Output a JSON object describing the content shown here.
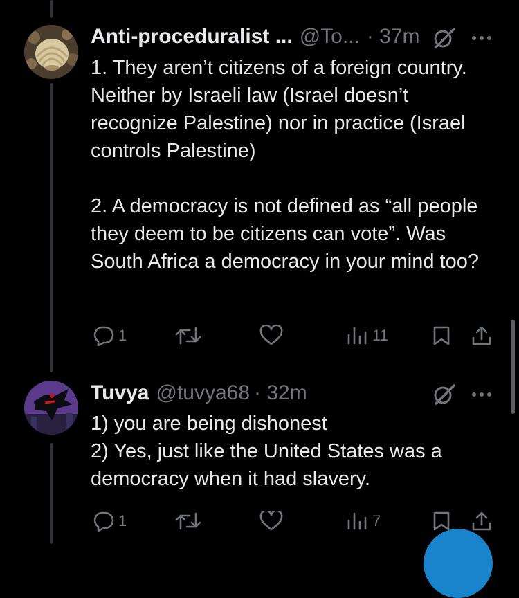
{
  "tweets": [
    {
      "author_name": "Anti-proceduralist ...",
      "handle": "@To...",
      "time": "· 37m",
      "text": "1. They aren’t citizens of a foreign country. Neither by Israeli law (Israel doesn’t recognize Palestine) nor in practice (Israel controls Palestine)\n\n2. A democracy is not defined as “all people they deem to be citizens can vote”. Was South Africa a democracy in your mind too?",
      "replies": "1",
      "reposts": "",
      "likes": "",
      "views": "11",
      "avatar_icon": "shell-photo-avatar"
    },
    {
      "author_name": "Tuvya",
      "handle": "@tuvya68",
      "time": "· 32m",
      "text": "1) you are being dishonest\n2) Yes, just like the United States was a democracy when it had slavery.",
      "replies": "1",
      "reposts": "",
      "likes": "",
      "views": "7",
      "avatar_icon": "batman-beyond-avatar"
    }
  ],
  "icons": {
    "reply": "reply-icon",
    "repost": "repost-icon",
    "like": "heart-icon",
    "views": "views-icon",
    "bookmark": "bookmark-icon",
    "share": "share-icon",
    "grok": "grok-icon",
    "more": "more-icon"
  },
  "colors": {
    "background": "#000000",
    "text": "#e7e9ea",
    "muted": "#71767b",
    "thread_line": "#333639",
    "accent": "#1d9bf0"
  }
}
